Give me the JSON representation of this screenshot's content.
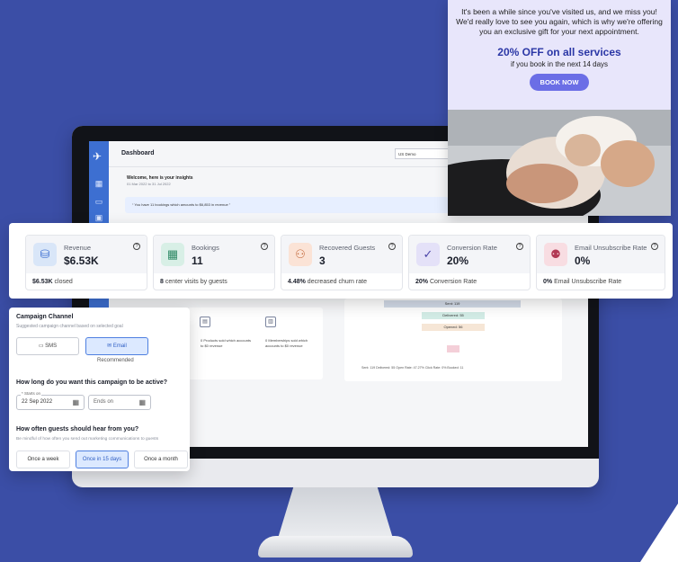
{
  "colors": {
    "background": "#3b4ea6",
    "accent": "#3d6fd1",
    "offer": "#2b37a6",
    "button": "#6b6ee6"
  },
  "email": {
    "message": "It's been a while since you've visited us, and we miss you! We'd really love to see you again, which is why we're offering you an exclusive gift for your next appointment.",
    "offer": "20% OFF on all services",
    "offer_sub": "if you book in the next 14 days",
    "cta": "BOOK NOW"
  },
  "dashboard": {
    "title": "Dashboard",
    "location": "US Demo",
    "welcome": "Welcome, here is your insights",
    "date_range": "01 Mar 2022  to  31 Jul 2022",
    "quote": "You have 11 bookings which amounts to $6,853 in revenue",
    "products_text": "0 Products sold which accounts to $0 revenue",
    "memberships_text": "0 Memberships sold which accounts to $0 revenue",
    "funnel": {
      "sent": "Sent: 119",
      "delivered": "Delivered: 55",
      "opened": "Opened: 56"
    },
    "legend": "Sent: 119      Delivered: 55      Open Rate: 47.27%      Click Rate: 0%      Booked: 11"
  },
  "metrics": [
    {
      "label": "Revenue",
      "value": "$6.53K",
      "foot_bold": "$6.53K",
      "foot_text": " closed",
      "icon": "revenue-icon"
    },
    {
      "label": "Bookings",
      "value": "11",
      "foot_bold": "8",
      "foot_text": " center visits by guests",
      "icon": "calendar-check-icon"
    },
    {
      "label": "Recovered Guests",
      "value": "3",
      "foot_bold": "4.48%",
      "foot_text": " decreased churn rate",
      "icon": "users-icon"
    },
    {
      "label": "Conversion Rate",
      "value": "20%",
      "foot_bold": "20%",
      "foot_text": " Conversion Rate",
      "icon": "check-circle-icon"
    },
    {
      "label": "Email Unsubscribe Rate",
      "value": "0%",
      "foot_bold": "0%",
      "foot_text": " Email Unsubscribe Rate",
      "icon": "user-remove-icon"
    }
  ],
  "campaign": {
    "channel_title": "Campaign Channel",
    "channel_sub": "Suggested campaign channel based on selected goal",
    "sms": "SMS",
    "email": "Email",
    "recommended": "Recommended",
    "duration_title": "How long do you want this campaign to be active?",
    "starts_on_label": "Starts on",
    "starts_on": "22 Sep 2022",
    "ends_on": "Ends on",
    "frequency_title": "How often guests should hear from you?",
    "frequency_sub": "Be mindful of how often you send out marketing communications to guests",
    "freq_options": [
      "Once a week",
      "Once in 15 days",
      "Once a month"
    ]
  }
}
